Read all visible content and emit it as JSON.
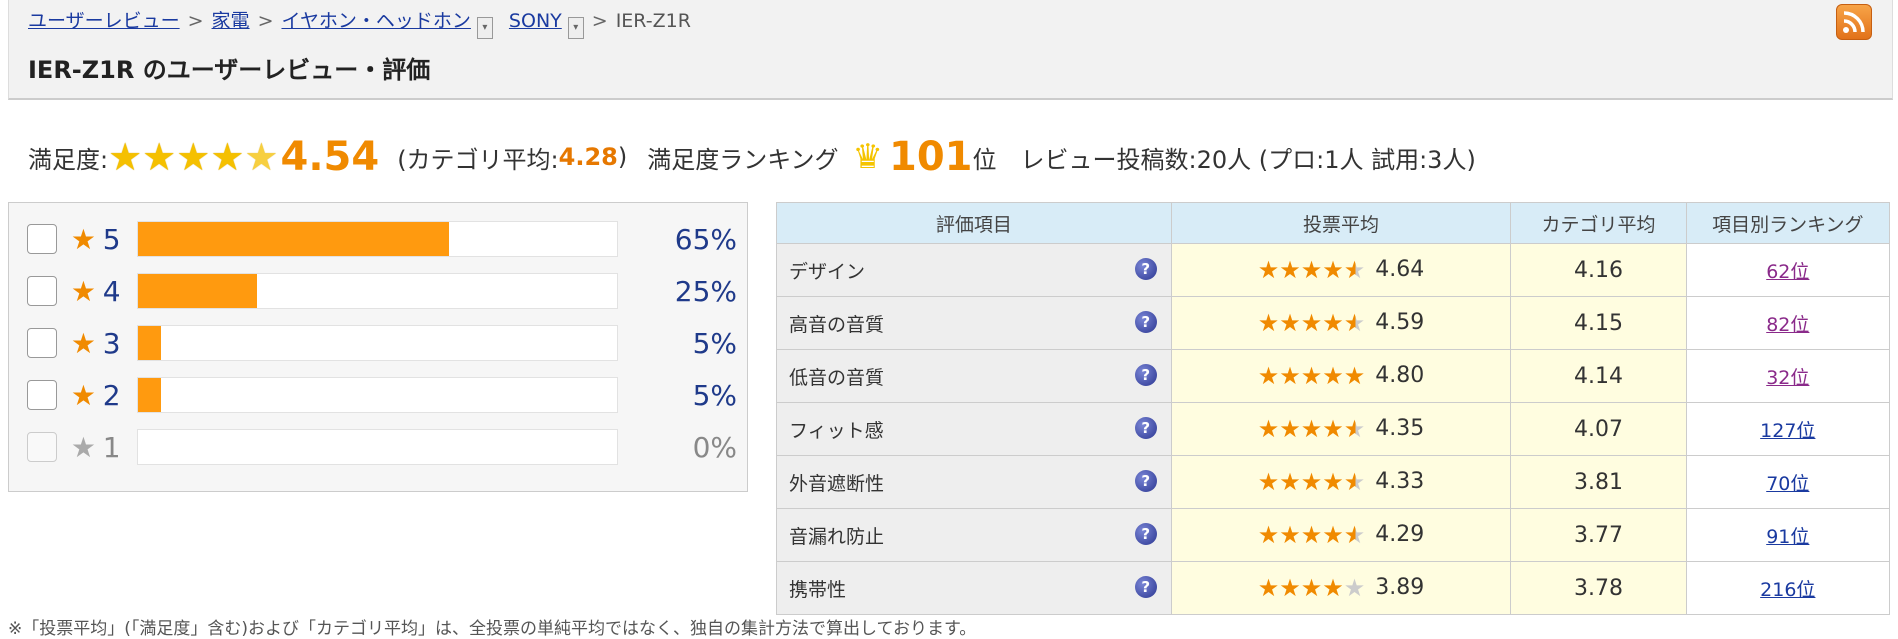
{
  "breadcrumb": {
    "links": [
      "ユーザーレビュー",
      "家電",
      "イヤホン・ヘッドホン",
      "SONY"
    ],
    "current": "IER-Z1R",
    "sep": ">"
  },
  "page_title": "IER-Z1R のユーザーレビュー・評価",
  "summary": {
    "satisfaction_label": "満足度:",
    "satisfaction_value": "4.54",
    "category_avg_prefix": "(カテゴリ平均:",
    "category_avg_value": "4.28",
    "category_avg_suffix": ")",
    "ranking_label": "満足度ランキング",
    "ranking_value": "101",
    "ranking_suffix": "位",
    "review_count_text": "レビュー投稿数:20人 (プロ:1人 試用:3人)"
  },
  "distribution": [
    {
      "star": "5",
      "percent": "65%",
      "ratio": 0.65,
      "enabled": true
    },
    {
      "star": "4",
      "percent": "25%",
      "ratio": 0.25,
      "enabled": true
    },
    {
      "star": "3",
      "percent": "5%",
      "ratio": 0.05,
      "enabled": true
    },
    {
      "star": "2",
      "percent": "5%",
      "ratio": 0.05,
      "enabled": true
    },
    {
      "star": "1",
      "percent": "0%",
      "ratio": 0.0,
      "enabled": false
    }
  ],
  "table": {
    "headers": [
      "評価項目",
      "投票平均",
      "カテゴリ平均",
      "項目別ランキング"
    ],
    "rows": [
      {
        "name": "デザイン",
        "vote": "4.64",
        "stars": [
          1,
          1,
          1,
          1,
          0.5
        ],
        "cat": "4.16",
        "rank": "62位",
        "visited": true
      },
      {
        "name": "高音の音質",
        "vote": "4.59",
        "stars": [
          1,
          1,
          1,
          1,
          0.5
        ],
        "cat": "4.15",
        "rank": "82位",
        "visited": true
      },
      {
        "name": "低音の音質",
        "vote": "4.80",
        "stars": [
          1,
          1,
          1,
          1,
          1
        ],
        "cat": "4.14",
        "rank": "32位",
        "visited": true
      },
      {
        "name": "フィット感",
        "vote": "4.35",
        "stars": [
          1,
          1,
          1,
          1,
          0.5
        ],
        "cat": "4.07",
        "rank": "127位",
        "visited": false
      },
      {
        "name": "外音遮断性",
        "vote": "4.33",
        "stars": [
          1,
          1,
          1,
          1,
          0.5
        ],
        "cat": "3.81",
        "rank": "70位",
        "visited": false
      },
      {
        "name": "音漏れ防止",
        "vote": "4.29",
        "stars": [
          1,
          1,
          1,
          1,
          0.5
        ],
        "cat": "3.77",
        "rank": "91位",
        "visited": false
      },
      {
        "name": "携帯性",
        "vote": "3.89",
        "stars": [
          1,
          1,
          1,
          1,
          0
        ],
        "cat": "3.78",
        "rank": "216位",
        "visited": false
      }
    ]
  },
  "footnote": "※「投票平均」(「満足度」含む)および「カテゴリ平均」は、全投票の単純平均ではなく、独自の集計方法で算出しております。",
  "icons": {
    "rss": "rss-icon",
    "help": "question-icon",
    "crown": "crown-icon",
    "star": "star-icon",
    "dropdown": "dropdown-icon"
  },
  "colors": {
    "accent": "#f08a00",
    "bar": "#ff9a0f",
    "link": "#1a3aa0"
  }
}
